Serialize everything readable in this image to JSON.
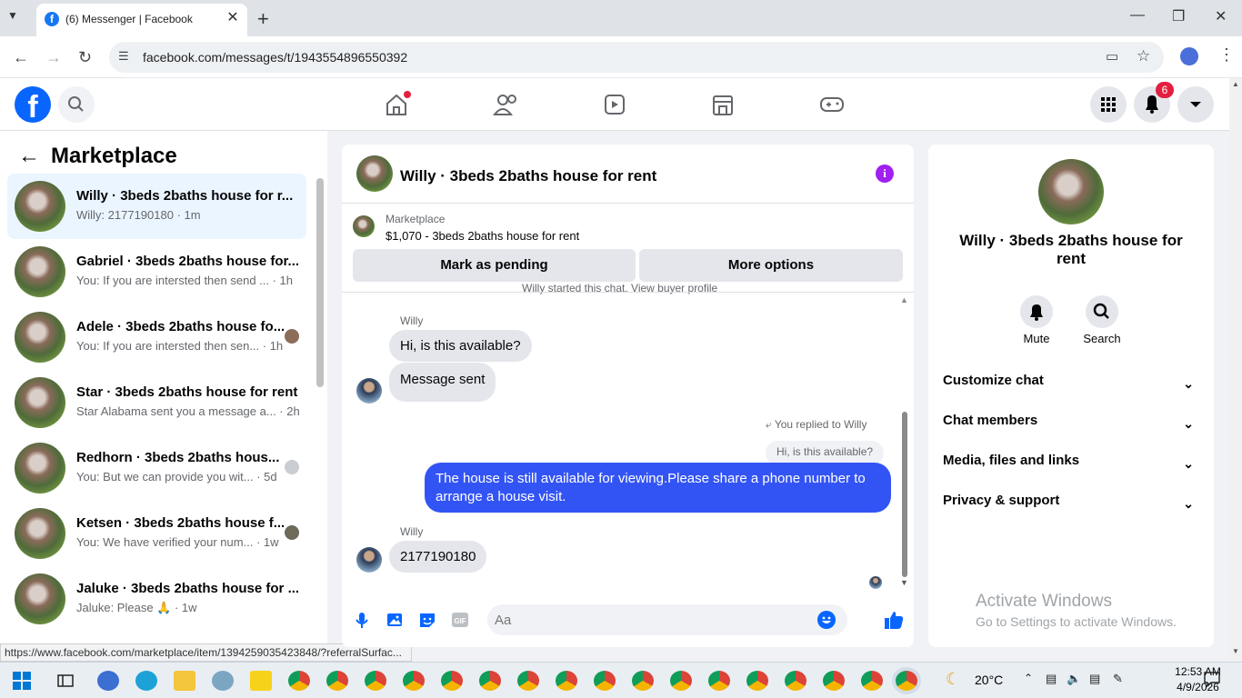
{
  "browser": {
    "tab_title": "(6) Messenger | Facebook",
    "url": "facebook.com/messages/t/1943554896550392",
    "status_url": "https://www.facebook.com/marketplace/item/1394259035423848/?referralSurfac..."
  },
  "fbnav": {
    "notification_count": "6"
  },
  "left": {
    "title": "Marketplace",
    "conversations": [
      {
        "name": "Willy · 3beds 2baths house for r...",
        "preview": "Willy: 2177190180 · 1m",
        "active": true
      },
      {
        "name": "Gabriel · 3beds 2baths house for...",
        "preview": "You: If you are intersted then send ... · 1h"
      },
      {
        "name": "Adele · 3beds 2baths house fo...",
        "preview": "You: If you are intersted then sen... · 1h"
      },
      {
        "name": "Star · 3beds 2baths house for rent",
        "preview": "Star Alabama sent you a message a... · 2h"
      },
      {
        "name": "Redhorn · 3beds 2baths hous...",
        "preview": "You: But we can provide you wit... · 5d"
      },
      {
        "name": "Ketsen · 3beds 2baths house f...",
        "preview": "You: We have verified your num... · 1w"
      },
      {
        "name": "Jaluke · 3beds 2baths house for ...",
        "preview": "Jaluke: Please 🙏 · 1w"
      }
    ]
  },
  "chat": {
    "title": "Willy · 3beds 2baths house for rent",
    "marketplace_label": "Marketplace",
    "listing": "$1,070 - 3beds 2baths house for rent",
    "mark_pending": "Mark as pending",
    "more_options": "More options",
    "started_note": "Willy started this chat. View buyer profile",
    "messages": {
      "sender1": "Willy",
      "msg1": "Hi, is this available?",
      "msg2": "Message sent",
      "replied_to": "You replied to Willy",
      "quoted": "Hi, is this available?",
      "msg3": "The house is still available for viewing.Please share a phone number to arrange a house visit.",
      "sender2": "Willy",
      "msg4": "2177190180"
    },
    "composer_placeholder": "Aa"
  },
  "right": {
    "name": "Willy · 3beds 2baths house for rent",
    "mute": "Mute",
    "search": "Search",
    "rows": [
      "Customize chat",
      "Chat members",
      "Media, files and links",
      "Privacy & support"
    ]
  },
  "watermark": {
    "line1": "Activate Windows",
    "line2": "Go to Settings to activate Windows."
  },
  "taskbar": {
    "temperature": "20°C",
    "time": "12:53 AM",
    "date": "4/9/2026"
  }
}
